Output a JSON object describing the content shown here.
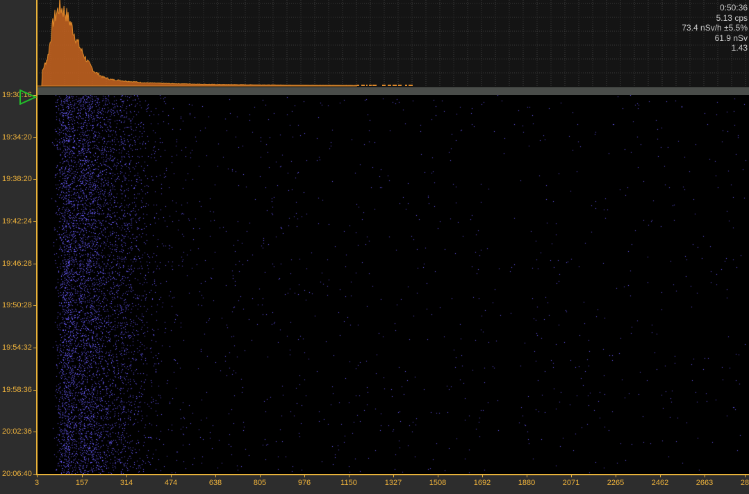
{
  "stats": {
    "elapsed": "0:50:36",
    "count_rate": "5.13 cps",
    "dose_rate": "73.4 nSv/h ±5.5%",
    "dose": "61.9 nSv",
    "ratio": "1.43"
  },
  "colors": {
    "axis": "#e8b23a",
    "spectrum_fill": "#c8641e",
    "spectrum_line": "#e08a2a",
    "waterfall_dots": "#6a5cff",
    "marker": "#22c02a"
  },
  "time_axis": {
    "labels": [
      "19:30:16",
      "19:34:20",
      "19:38:20",
      "19:42:24",
      "19:46:28",
      "19:50:28",
      "19:54:32",
      "19:58:36",
      "20:02:36",
      "20:06:40"
    ]
  },
  "energy_axis": {
    "labels": [
      "3",
      "157",
      "314",
      "474",
      "638",
      "805",
      "976",
      "1150",
      "1327",
      "1508",
      "1692",
      "1880",
      "2071",
      "2265",
      "2462",
      "2663",
      "28"
    ]
  },
  "chart_data": {
    "type": "area",
    "x": [
      3,
      40,
      60,
      80,
      100,
      120,
      140,
      157,
      180,
      200,
      230,
      260,
      314,
      380,
      474,
      638,
      805,
      976,
      1150
    ],
    "values": [
      0.02,
      0.35,
      0.8,
      0.97,
      0.9,
      0.75,
      0.55,
      0.42,
      0.28,
      0.18,
      0.11,
      0.08,
      0.06,
      0.04,
      0.03,
      0.02,
      0.015,
      0.01,
      0.008
    ],
    "xlabel": "",
    "ylabel": "",
    "xlim": [
      3,
      2800
    ],
    "grid": true
  }
}
